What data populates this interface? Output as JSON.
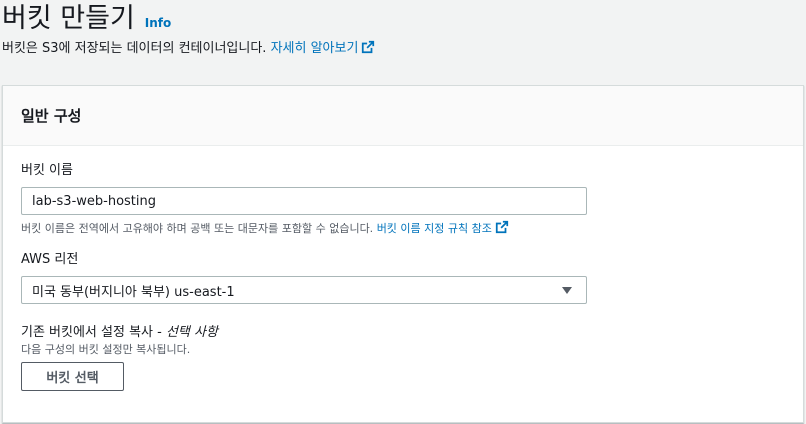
{
  "header": {
    "title": "버킷 만들기",
    "info_label": "Info",
    "description": "버킷은 S3에 저장되는 데이터의 컨테이너입니다.",
    "learn_more_label": "자세히 알아보기"
  },
  "general_config": {
    "section_title": "일반 구성",
    "bucket_name": {
      "label": "버킷 이름",
      "value": "lab-s3-web-hosting",
      "constraint_text": "버킷 이름은 전역에서 고유해야 하며 공백 또는 대문자를 포함할 수 없습니다.",
      "rules_link_label": "버킷 이름 지정 규칙 참조"
    },
    "region": {
      "label": "AWS 리전",
      "selected_value": "미국 동부(버지니아 북부) us-east-1"
    },
    "copy_settings": {
      "label": "기존 버킷에서 설정 복사 - ",
      "label_optional": "선택 사항",
      "description": "다음 구성의 버킷 설정만 복사됩니다.",
      "button_label": "버킷 선택"
    }
  },
  "colors": {
    "link": "#0073bb",
    "text": "#16191f",
    "secondary_text": "#545b64",
    "background": "#f2f3f3"
  },
  "icons": {
    "external_link": "external-link-icon",
    "dropdown_caret": "caret-down-icon"
  }
}
